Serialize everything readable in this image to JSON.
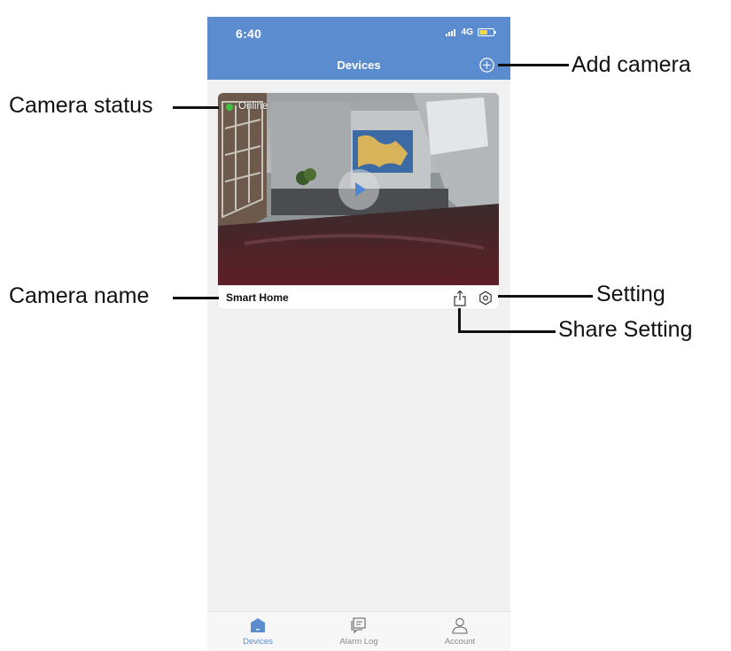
{
  "status_bar": {
    "time": "6:40",
    "network": "4G"
  },
  "header": {
    "title": "Devices",
    "add_icon": "plus-circle-icon"
  },
  "camera_card": {
    "status": "Online",
    "status_color": "#3fc23d",
    "name": "Smart Home",
    "play_icon": "play-icon",
    "share_icon": "share-icon",
    "setting_icon": "hexagon-gear-icon"
  },
  "tabs": [
    {
      "label": "Devices",
      "icon": "home-icon",
      "active": true
    },
    {
      "label": "Alarm Log",
      "icon": "message-icon",
      "active": false
    },
    {
      "label": "Account",
      "icon": "user-icon",
      "active": false
    }
  ],
  "annotations": {
    "add_camera": "Add camera",
    "camera_status": "Camera status",
    "camera_name": "Camera name",
    "setting": "Setting",
    "share_setting": "Share Setting"
  },
  "colors": {
    "accent": "#5b8ccf",
    "battery": "#f2d94a",
    "background": "#f1f1f1"
  }
}
